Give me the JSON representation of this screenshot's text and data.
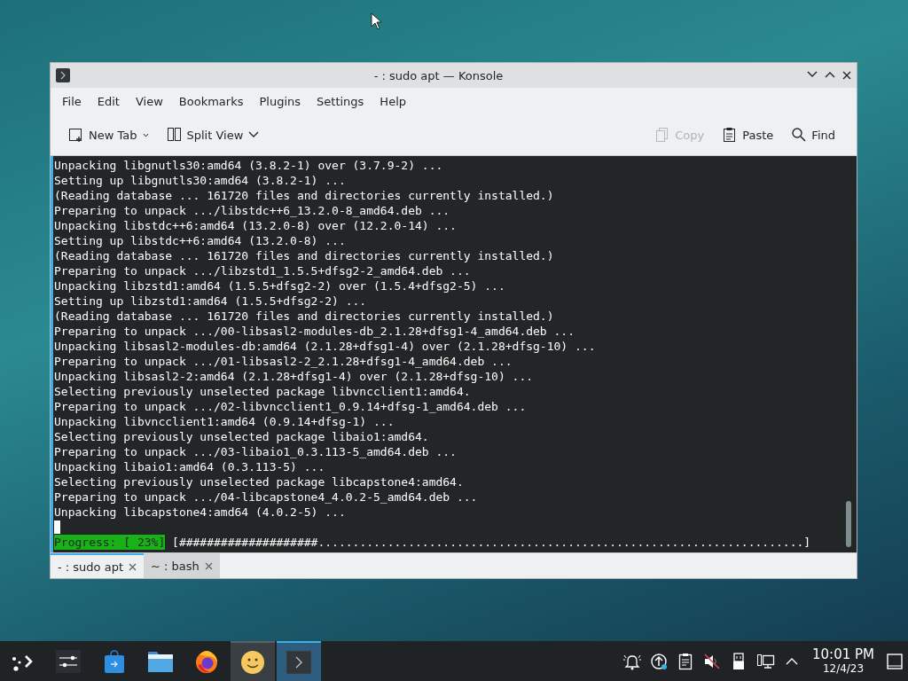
{
  "window": {
    "title": "- : sudo apt — Konsole"
  },
  "menu": [
    "File",
    "Edit",
    "View",
    "Bookmarks",
    "Plugins",
    "Settings",
    "Help"
  ],
  "toolbar": [
    {
      "kind": "new-tab",
      "label": "New Tab",
      "disabled": false
    },
    {
      "kind": "split-view",
      "label": "Split View",
      "disabled": false
    },
    {
      "kind": "copy",
      "label": "Copy",
      "disabled": true
    },
    {
      "kind": "paste",
      "label": "Paste",
      "disabled": false
    },
    {
      "kind": "find",
      "label": "Find",
      "disabled": false
    }
  ],
  "terminal": {
    "lines": [
      "Unpacking libgnutls30:amd64 (3.8.2-1) over (3.7.9-2) ...",
      "Setting up libgnutls30:amd64 (3.8.2-1) ...",
      "(Reading database ... 161720 files and directories currently installed.)",
      "Preparing to unpack .../libstdc++6_13.2.0-8_amd64.deb ...",
      "Unpacking libstdc++6:amd64 (13.2.0-8) over (12.2.0-14) ...",
      "Setting up libstdc++6:amd64 (13.2.0-8) ...",
      "(Reading database ... 161720 files and directories currently installed.)",
      "Preparing to unpack .../libzstd1_1.5.5+dfsg2-2_amd64.deb ...",
      "Unpacking libzstd1:amd64 (1.5.5+dfsg2-2) over (1.5.4+dfsg2-5) ...",
      "Setting up libzstd1:amd64 (1.5.5+dfsg2-2) ...",
      "(Reading database ... 161720 files and directories currently installed.)",
      "Preparing to unpack .../00-libsasl2-modules-db_2.1.28+dfsg1-4_amd64.deb ...",
      "Unpacking libsasl2-modules-db:amd64 (2.1.28+dfsg1-4) over (2.1.28+dfsg-10) ...",
      "Preparing to unpack .../01-libsasl2-2_2.1.28+dfsg1-4_amd64.deb ...",
      "Unpacking libsasl2-2:amd64 (2.1.28+dfsg1-4) over (2.1.28+dfsg-10) ...",
      "Selecting previously unselected package libvncclient1:amd64.",
      "Preparing to unpack .../02-libvncclient1_0.9.14+dfsg-1_amd64.deb ...",
      "Unpacking libvncclient1:amd64 (0.9.14+dfsg-1) ...",
      "Selecting previously unselected package libaio1:amd64.",
      "Preparing to unpack .../03-libaio1_0.3.113-5_amd64.deb ...",
      "Unpacking libaio1:amd64 (0.3.113-5) ...",
      "Selecting previously unselected package libcapstone4:amd64.",
      "Preparing to unpack .../04-libcapstone4_4.0.2-5_amd64.deb ...",
      "Unpacking libcapstone4:amd64 (4.0.2-5) ..."
    ],
    "progress": {
      "label": "Progress: [ 23%]",
      "bar": "[####################......................................................................]"
    }
  },
  "tabs": [
    {
      "label": "- : sudo apt",
      "selected": true
    },
    {
      "label": "~ : bash",
      "selected": false
    }
  ],
  "taskbar": {
    "tasks": [
      {
        "kind": "launcher",
        "running": false,
        "selected": false
      },
      {
        "kind": "settings",
        "running": false,
        "selected": false
      },
      {
        "kind": "store",
        "running": false,
        "selected": false
      },
      {
        "kind": "files",
        "running": false,
        "selected": false
      },
      {
        "kind": "browser",
        "running": false,
        "selected": false
      },
      {
        "kind": "smiley",
        "running": true,
        "selected": false
      },
      {
        "kind": "terminal",
        "running": true,
        "selected": true
      }
    ],
    "tray": [
      {
        "kind": "notifications"
      },
      {
        "kind": "update"
      },
      {
        "kind": "clipboard"
      },
      {
        "kind": "volume-muted"
      },
      {
        "kind": "usb"
      },
      {
        "kind": "network"
      },
      {
        "kind": "expand"
      }
    ],
    "clock": {
      "time": "10:01 PM",
      "date": "12/4/23"
    }
  }
}
